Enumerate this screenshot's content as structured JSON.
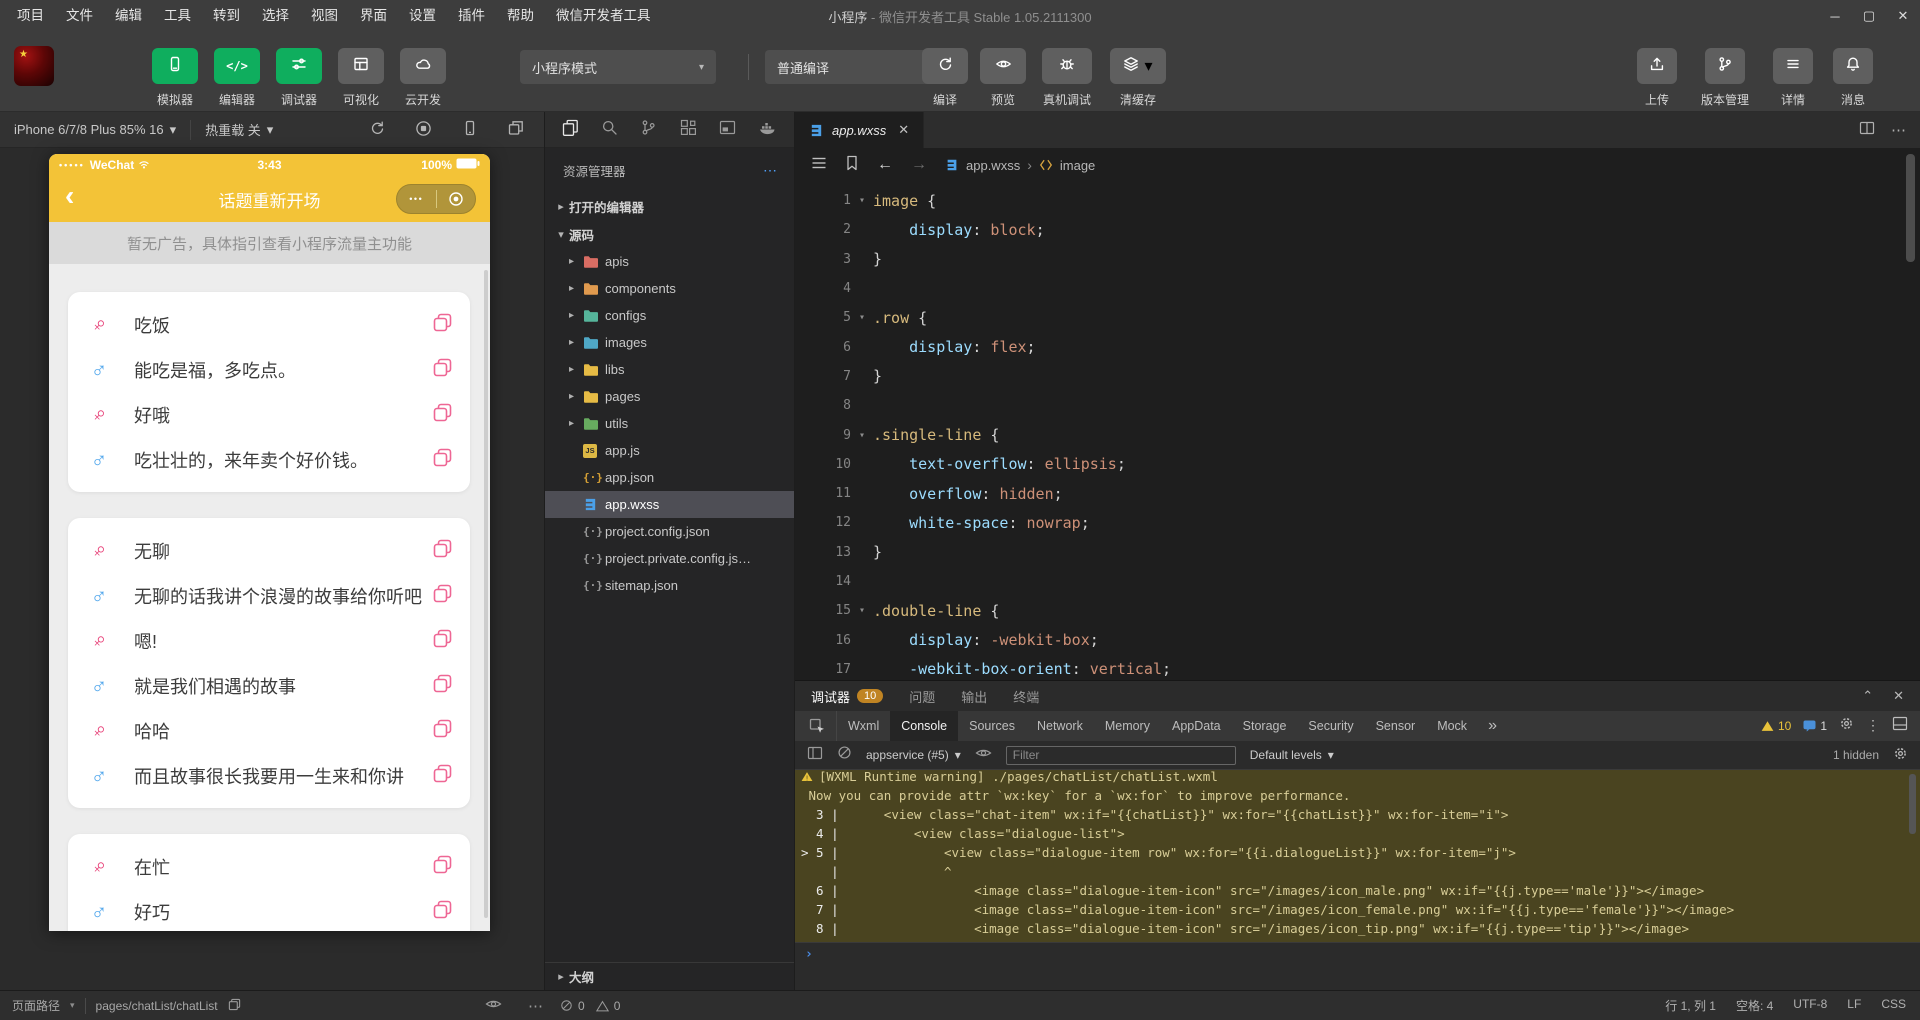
{
  "titlebar": {
    "menus": [
      "项目",
      "文件",
      "编辑",
      "工具",
      "转到",
      "选择",
      "视图",
      "界面",
      "设置",
      "插件",
      "帮助",
      "微信开发者工具"
    ],
    "title_app": "小程序",
    "title_rest": "-  微信开发者工具 Stable 1.05.2111300",
    "controls": {
      "min": "─",
      "max": "▢",
      "close": "✕"
    }
  },
  "toolbar": {
    "simulator": "模拟器",
    "editor": "编辑器",
    "debugger": "调试器",
    "visualize": "可视化",
    "cloud": "云开发",
    "mode": "小程序模式",
    "compile_mode": "普通编译",
    "compile": "编译",
    "preview": "预览",
    "device_debug": "真机调试",
    "clear_cache": "清缓存",
    "upload": "上传",
    "version": "版本管理",
    "details": "详情",
    "messages": "消息",
    "accent_green": "#0fae5e"
  },
  "simulator": {
    "device": "iPhone 6/7/8 Plus 85% 16",
    "hot_reload": "热重载 关",
    "phone": {
      "carrier": "WeChat",
      "time": "3:43",
      "battery": "100%",
      "nav_title": "话题重新开场",
      "notice": "暂无广告，具体指引查看小程序流量主功能",
      "female_color": "#e8437a",
      "male_color": "#52a7ec",
      "cards": [
        {
          "rows": [
            {
              "type": "female",
              "text": "吃饭"
            },
            {
              "type": "male",
              "text": "能吃是福，多吃点。"
            },
            {
              "type": "female",
              "text": "好哦"
            },
            {
              "type": "male",
              "text": "吃壮壮的，来年卖个好价钱。"
            }
          ]
        },
        {
          "rows": [
            {
              "type": "female",
              "text": "无聊"
            },
            {
              "type": "male",
              "text": "无聊的话我讲个浪漫的故事给你听吧"
            },
            {
              "type": "female",
              "text": "嗯!"
            },
            {
              "type": "male",
              "text": "就是我们相遇的故事"
            },
            {
              "type": "female",
              "text": "哈哈"
            },
            {
              "type": "male",
              "text": "而且故事很长我要用一生来和你讲"
            }
          ]
        },
        {
          "rows": [
            {
              "type": "female",
              "text": "在忙"
            },
            {
              "type": "male",
              "text": "好巧"
            },
            {
              "type": "female",
              "text": ""
            }
          ]
        }
      ]
    }
  },
  "explorer": {
    "title": "资源管理器",
    "open_editors": "打开的编辑器",
    "source": "源码",
    "outline": "大纲",
    "tree": [
      {
        "kind": "folder",
        "cls": "",
        "name": "apis",
        "color": "#d96d63"
      },
      {
        "kind": "folder",
        "cls": "",
        "name": "components",
        "color": "#e09a4e"
      },
      {
        "kind": "folder",
        "cls": "",
        "name": "configs",
        "color": "#56b59b"
      },
      {
        "kind": "folder",
        "cls": "",
        "name": "images",
        "color": "#4fa8c6"
      },
      {
        "kind": "folder",
        "cls": "",
        "name": "libs",
        "color": "#e6bb45"
      },
      {
        "kind": "folder",
        "cls": "",
        "name": "pages",
        "color": "#e6bb45"
      },
      {
        "kind": "folder",
        "cls": "",
        "name": "utils",
        "color": "#67ab5f"
      },
      {
        "kind": "js",
        "cls": "",
        "name": "app.js"
      },
      {
        "kind": "json",
        "cls": "",
        "name": "app.json"
      },
      {
        "kind": "wxss",
        "cls": "selected",
        "name": "app.wxss"
      },
      {
        "kind": "jsongray",
        "cls": "",
        "name": "project.config.json"
      },
      {
        "kind": "jsongray",
        "cls": "",
        "name": "project.private.config.js…"
      },
      {
        "kind": "jsongray",
        "cls": "",
        "name": "sitemap.json"
      }
    ]
  },
  "editor": {
    "tab": "app.wxss",
    "breadcrumb_file": "app.wxss",
    "breadcrumb_symbol": "image",
    "lines": [
      {
        "n": "1",
        "fold": "▾",
        "parts": [
          {
            "c": "sel",
            "t": "image"
          },
          {
            "c": "pun",
            "t": " {"
          }
        ]
      },
      {
        "n": "2",
        "fold": "",
        "parts": [
          {
            "c": "prop",
            "t": "    display"
          },
          {
            "c": "pun",
            "t": ": "
          },
          {
            "c": "val",
            "t": "block"
          },
          {
            "c": "pun",
            "t": ";"
          }
        ]
      },
      {
        "n": "3",
        "fold": "",
        "parts": [
          {
            "c": "pun",
            "t": "}"
          }
        ]
      },
      {
        "n": "4",
        "fold": "",
        "parts": []
      },
      {
        "n": "5",
        "fold": "▾",
        "parts": [
          {
            "c": "sel",
            "t": ".row"
          },
          {
            "c": "pun",
            "t": " {"
          }
        ]
      },
      {
        "n": "6",
        "fold": "",
        "parts": [
          {
            "c": "prop",
            "t": "    display"
          },
          {
            "c": "pun",
            "t": ": "
          },
          {
            "c": "val",
            "t": "flex"
          },
          {
            "c": "pun",
            "t": ";"
          }
        ]
      },
      {
        "n": "7",
        "fold": "",
        "parts": [
          {
            "c": "pun",
            "t": "}"
          }
        ]
      },
      {
        "n": "8",
        "fold": "",
        "parts": []
      },
      {
        "n": "9",
        "fold": "▾",
        "parts": [
          {
            "c": "sel",
            "t": ".single-line"
          },
          {
            "c": "pun",
            "t": " {"
          }
        ]
      },
      {
        "n": "10",
        "fold": "",
        "parts": [
          {
            "c": "prop",
            "t": "    text-overflow"
          },
          {
            "c": "pun",
            "t": ": "
          },
          {
            "c": "val",
            "t": "ellipsis"
          },
          {
            "c": "pun",
            "t": ";"
          }
        ]
      },
      {
        "n": "11",
        "fold": "",
        "parts": [
          {
            "c": "prop",
            "t": "    overflow"
          },
          {
            "c": "pun",
            "t": ": "
          },
          {
            "c": "val",
            "t": "hidden"
          },
          {
            "c": "pun",
            "t": ";"
          }
        ]
      },
      {
        "n": "12",
        "fold": "",
        "parts": [
          {
            "c": "prop",
            "t": "    white-space"
          },
          {
            "c": "pun",
            "t": ": "
          },
          {
            "c": "val",
            "t": "nowrap"
          },
          {
            "c": "pun",
            "t": ";"
          }
        ]
      },
      {
        "n": "13",
        "fold": "",
        "parts": [
          {
            "c": "pun",
            "t": "}"
          }
        ]
      },
      {
        "n": "14",
        "fold": "",
        "parts": []
      },
      {
        "n": "15",
        "fold": "▾",
        "parts": [
          {
            "c": "sel",
            "t": ".double-line"
          },
          {
            "c": "pun",
            "t": " {"
          }
        ]
      },
      {
        "n": "16",
        "fold": "",
        "parts": [
          {
            "c": "prop",
            "t": "    display"
          },
          {
            "c": "pun",
            "t": ": "
          },
          {
            "c": "val",
            "t": "-webkit-box"
          },
          {
            "c": "pun",
            "t": ";"
          }
        ]
      },
      {
        "n": "17",
        "fold": "",
        "parts": [
          {
            "c": "prop",
            "t": "    -webkit-box-orient"
          },
          {
            "c": "pun",
            "t": ": "
          },
          {
            "c": "val",
            "t": "vertical"
          },
          {
            "c": "pun",
            "t": ";"
          }
        ]
      }
    ]
  },
  "dbg": {
    "panel_tabs": [
      {
        "label": "调试器",
        "badge": "10",
        "cls": "active"
      },
      {
        "label": "问题",
        "badge": "",
        "cls": ""
      },
      {
        "label": "输出",
        "badge": "",
        "cls": ""
      },
      {
        "label": "终端",
        "badge": "",
        "cls": ""
      }
    ],
    "devtools_tabs": [
      {
        "label": "Wxml",
        "cls": ""
      },
      {
        "label": "Console",
        "cls": "active"
      },
      {
        "label": "Sources",
        "cls": ""
      },
      {
        "label": "Network",
        "cls": ""
      },
      {
        "label": "Memory",
        "cls": ""
      },
      {
        "label": "AppData",
        "cls": ""
      },
      {
        "label": "Storage",
        "cls": ""
      },
      {
        "label": "Security",
        "cls": ""
      },
      {
        "label": "Sensor",
        "cls": ""
      },
      {
        "label": "Mock",
        "cls": ""
      }
    ],
    "warn_count": "10",
    "info_count": "1",
    "console": {
      "context": "appservice (#5)",
      "filter_placeholder": "Filter",
      "levels": "Default levels",
      "hidden": "1 hidden",
      "warning_title": "[WXML Runtime warning] ./pages/chatList/chatList.wxml",
      "lines": [
        {
          "n": "",
          "t": " Now you can provide attr `wx:key` for a `wx:for` to improve performance."
        },
        {
          "n": "  3 |",
          "t": "      <view class=\"chat-item\" wx:if=\"{{chatList}}\" wx:for=\"{{chatList}}\" wx:for-item=\"i\">"
        },
        {
          "n": "  4 |",
          "t": "          <view class=\"dialogue-list\">"
        },
        {
          "n": "> 5 |",
          "t": "              <view class=\"dialogue-item row\" wx:for=\"{{i.dialogueList}}\" wx:for-item=\"j\">"
        },
        {
          "n": "    |",
          "t": "              ^"
        },
        {
          "n": "  6 |",
          "t": "                  <image class=\"dialogue-item-icon\" src=\"/images/icon_male.png\" wx:if=\"{{j.type=='male'}}\"></image>"
        },
        {
          "n": "  7 |",
          "t": "                  <image class=\"dialogue-item-icon\" src=\"/images/icon_female.png\" wx:if=\"{{j.type=='female'}}\"></image>"
        },
        {
          "n": "  8 |",
          "t": "                  <image class=\"dialogue-item-icon\" src=\"/images/icon_tip.png\" wx:if=\"{{j.type=='tip'}}\"></image>"
        }
      ]
    }
  },
  "statusbar": {
    "path_label": "页面路径",
    "path": "pages/chatList/chatList",
    "error_count": "0",
    "warn_count": "0",
    "right_items": [
      "行 1, 列 1",
      "空格: 4",
      "UTF-8",
      "LF",
      "CSS"
    ]
  }
}
